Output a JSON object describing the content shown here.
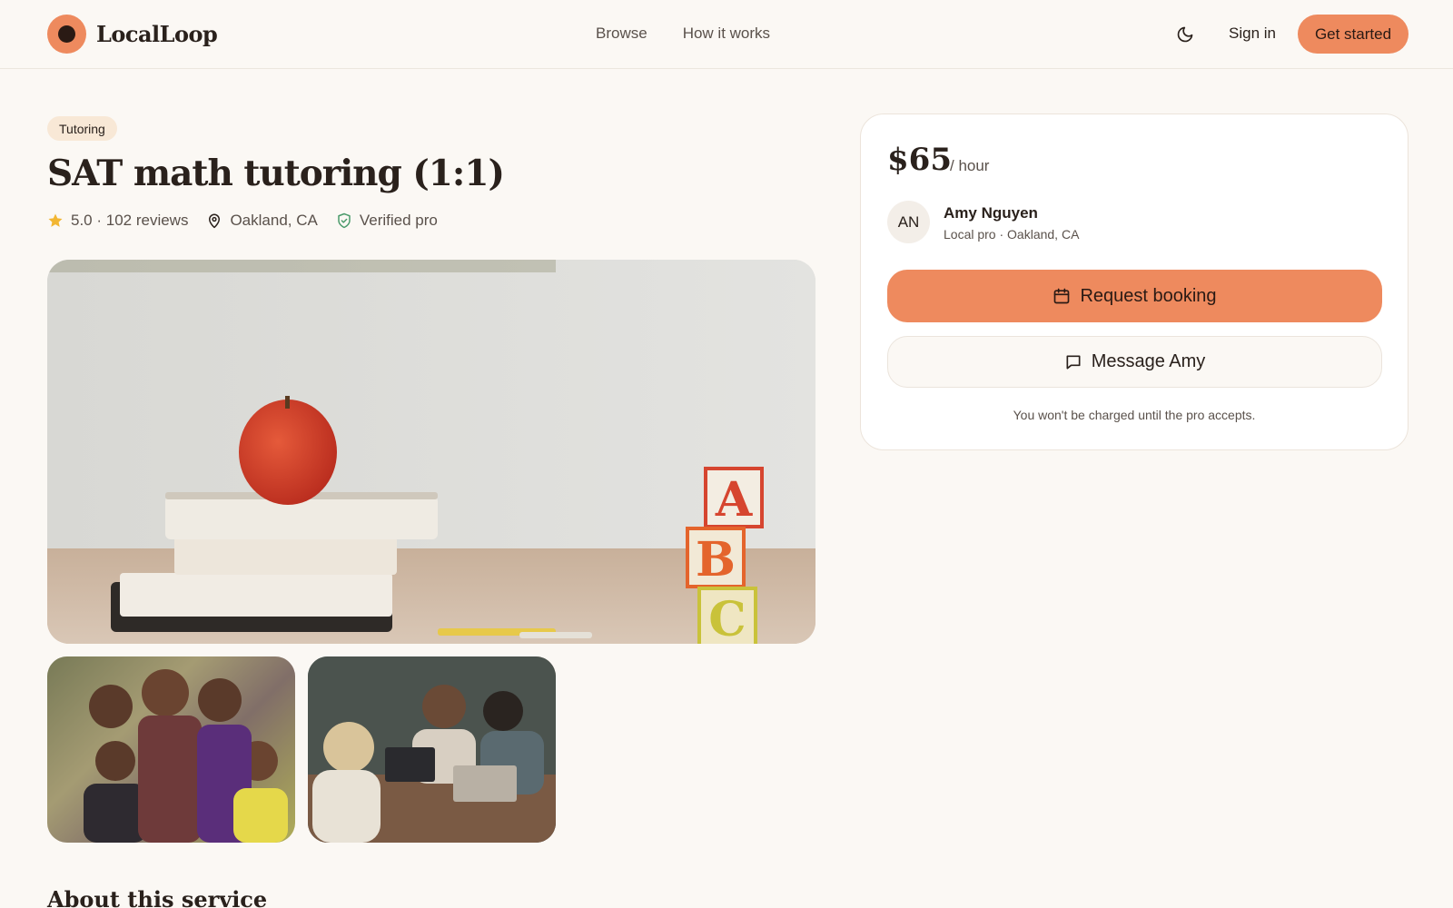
{
  "app": {
    "name": "LocalLoop"
  },
  "nav": {
    "items": [
      {
        "label": "Browse"
      },
      {
        "label": "How it works"
      }
    ]
  },
  "header": {
    "sign_in": "Sign in",
    "get_started": "Get started"
  },
  "listing": {
    "category": "Tutoring",
    "title": "SAT math tutoring (1:1)",
    "rating": "5.0 · 102 reviews",
    "location": "Oakland, CA",
    "verified": "Verified pro"
  },
  "booking": {
    "price": "$65",
    "per": "/ hour",
    "pro": {
      "initials": "AN",
      "name": "Amy Nguyen",
      "subtitle": "Local pro · Oakland, CA"
    },
    "request_label": "Request booking",
    "message_label": "Message Amy",
    "note": "You won't be charged until the pro accepts."
  },
  "sections": {
    "about_title": "About this service"
  },
  "colors": {
    "accent": "#ee8a5e",
    "background": "#fbf8f4",
    "star": "#f2b632",
    "verified": "#4a9a6a"
  },
  "icons": {
    "theme": "moon-icon",
    "star": "star-icon",
    "location": "map-pin-icon",
    "verified": "shield-check-icon",
    "calendar": "calendar-icon",
    "message": "message-icon"
  }
}
